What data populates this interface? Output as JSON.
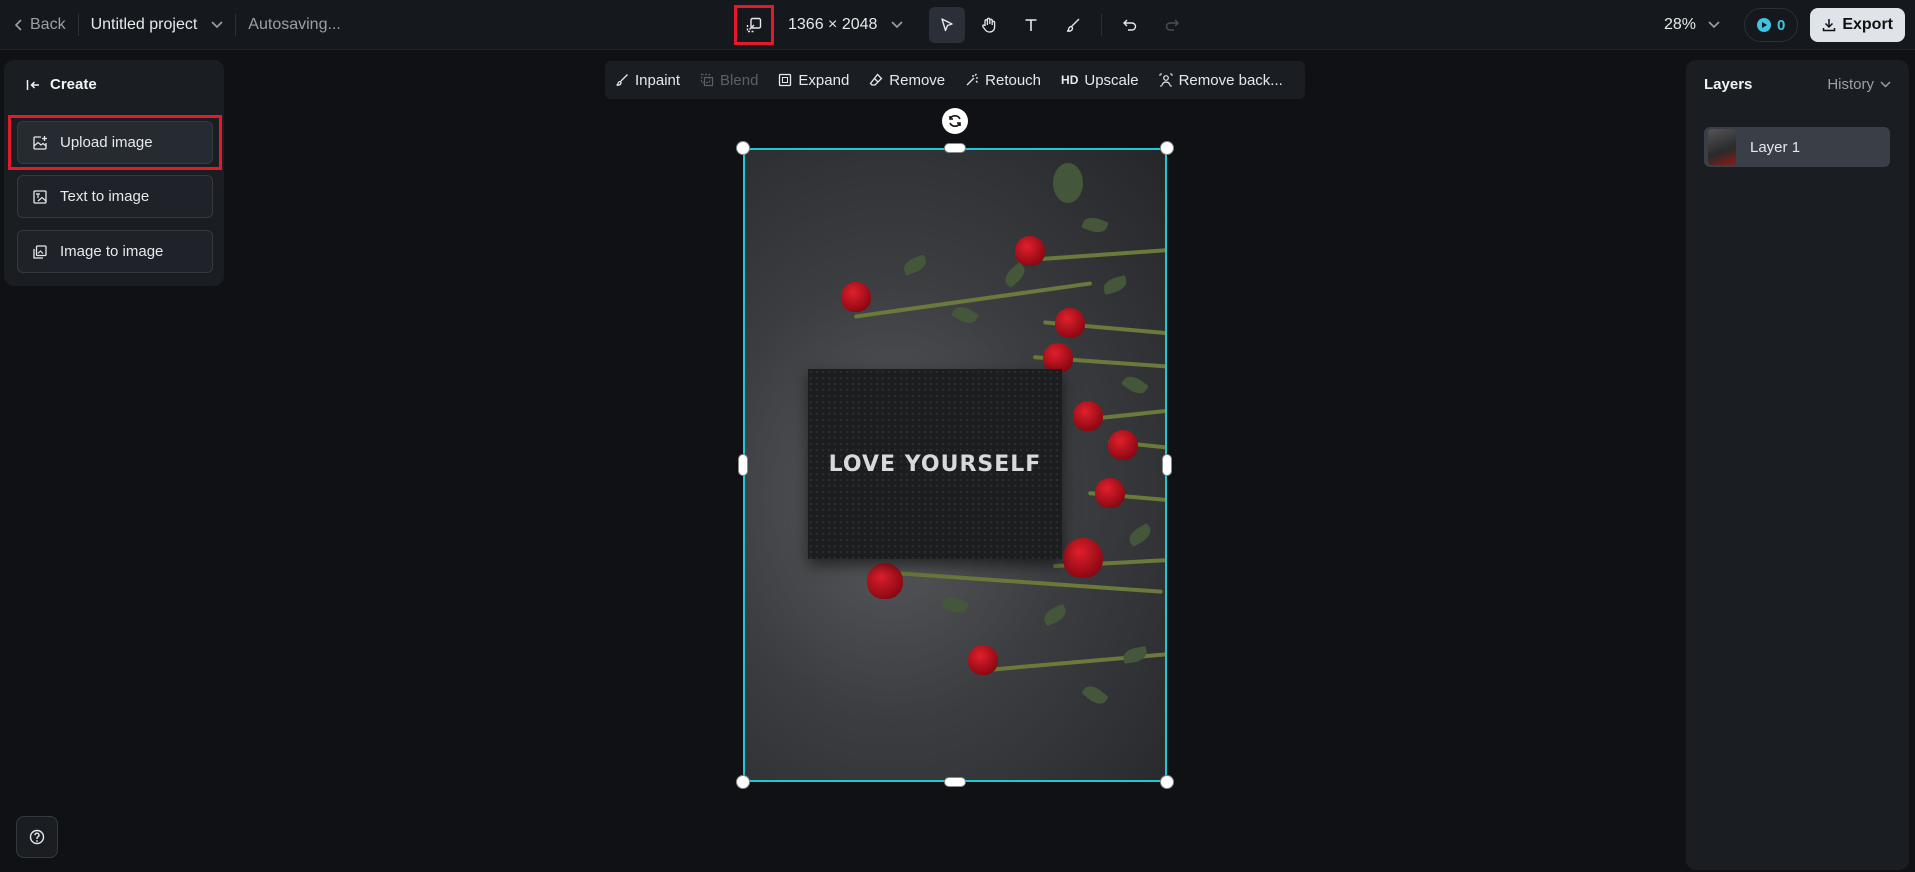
{
  "topbar": {
    "back_label": "Back",
    "project_name": "Untitled project",
    "autosave_status": "Autosaving...",
    "canvas_dimensions": "1366 × 2048",
    "zoom_level": "28%",
    "credits": "0",
    "export_label": "Export"
  },
  "tools": [
    "select-tool",
    "hand-tool",
    "text-tool",
    "brush-tool",
    "undo",
    "redo"
  ],
  "left_panel": {
    "title": "Create",
    "buttons": [
      {
        "label": "Upload image"
      },
      {
        "label": "Text to image"
      },
      {
        "label": "Image to image"
      }
    ]
  },
  "edit_toolbar": {
    "items": [
      {
        "label": "Inpaint",
        "enabled": true
      },
      {
        "label": "Blend",
        "enabled": false
      },
      {
        "label": "Expand",
        "enabled": true
      },
      {
        "label": "Remove",
        "enabled": true
      },
      {
        "label": "Retouch",
        "enabled": true
      },
      {
        "label": "Upscale",
        "prefix": "HD",
        "enabled": true
      },
      {
        "label": "Remove back...",
        "enabled": true
      }
    ]
  },
  "canvas": {
    "image_text": "LOVE YOURSELF"
  },
  "right_panel": {
    "title": "Layers",
    "history_label": "History",
    "layers": [
      {
        "name": "Layer 1"
      }
    ]
  },
  "colors": {
    "accent": "#1fc8d4",
    "highlight": "#e5192c",
    "credits": "#3fc3e0"
  }
}
